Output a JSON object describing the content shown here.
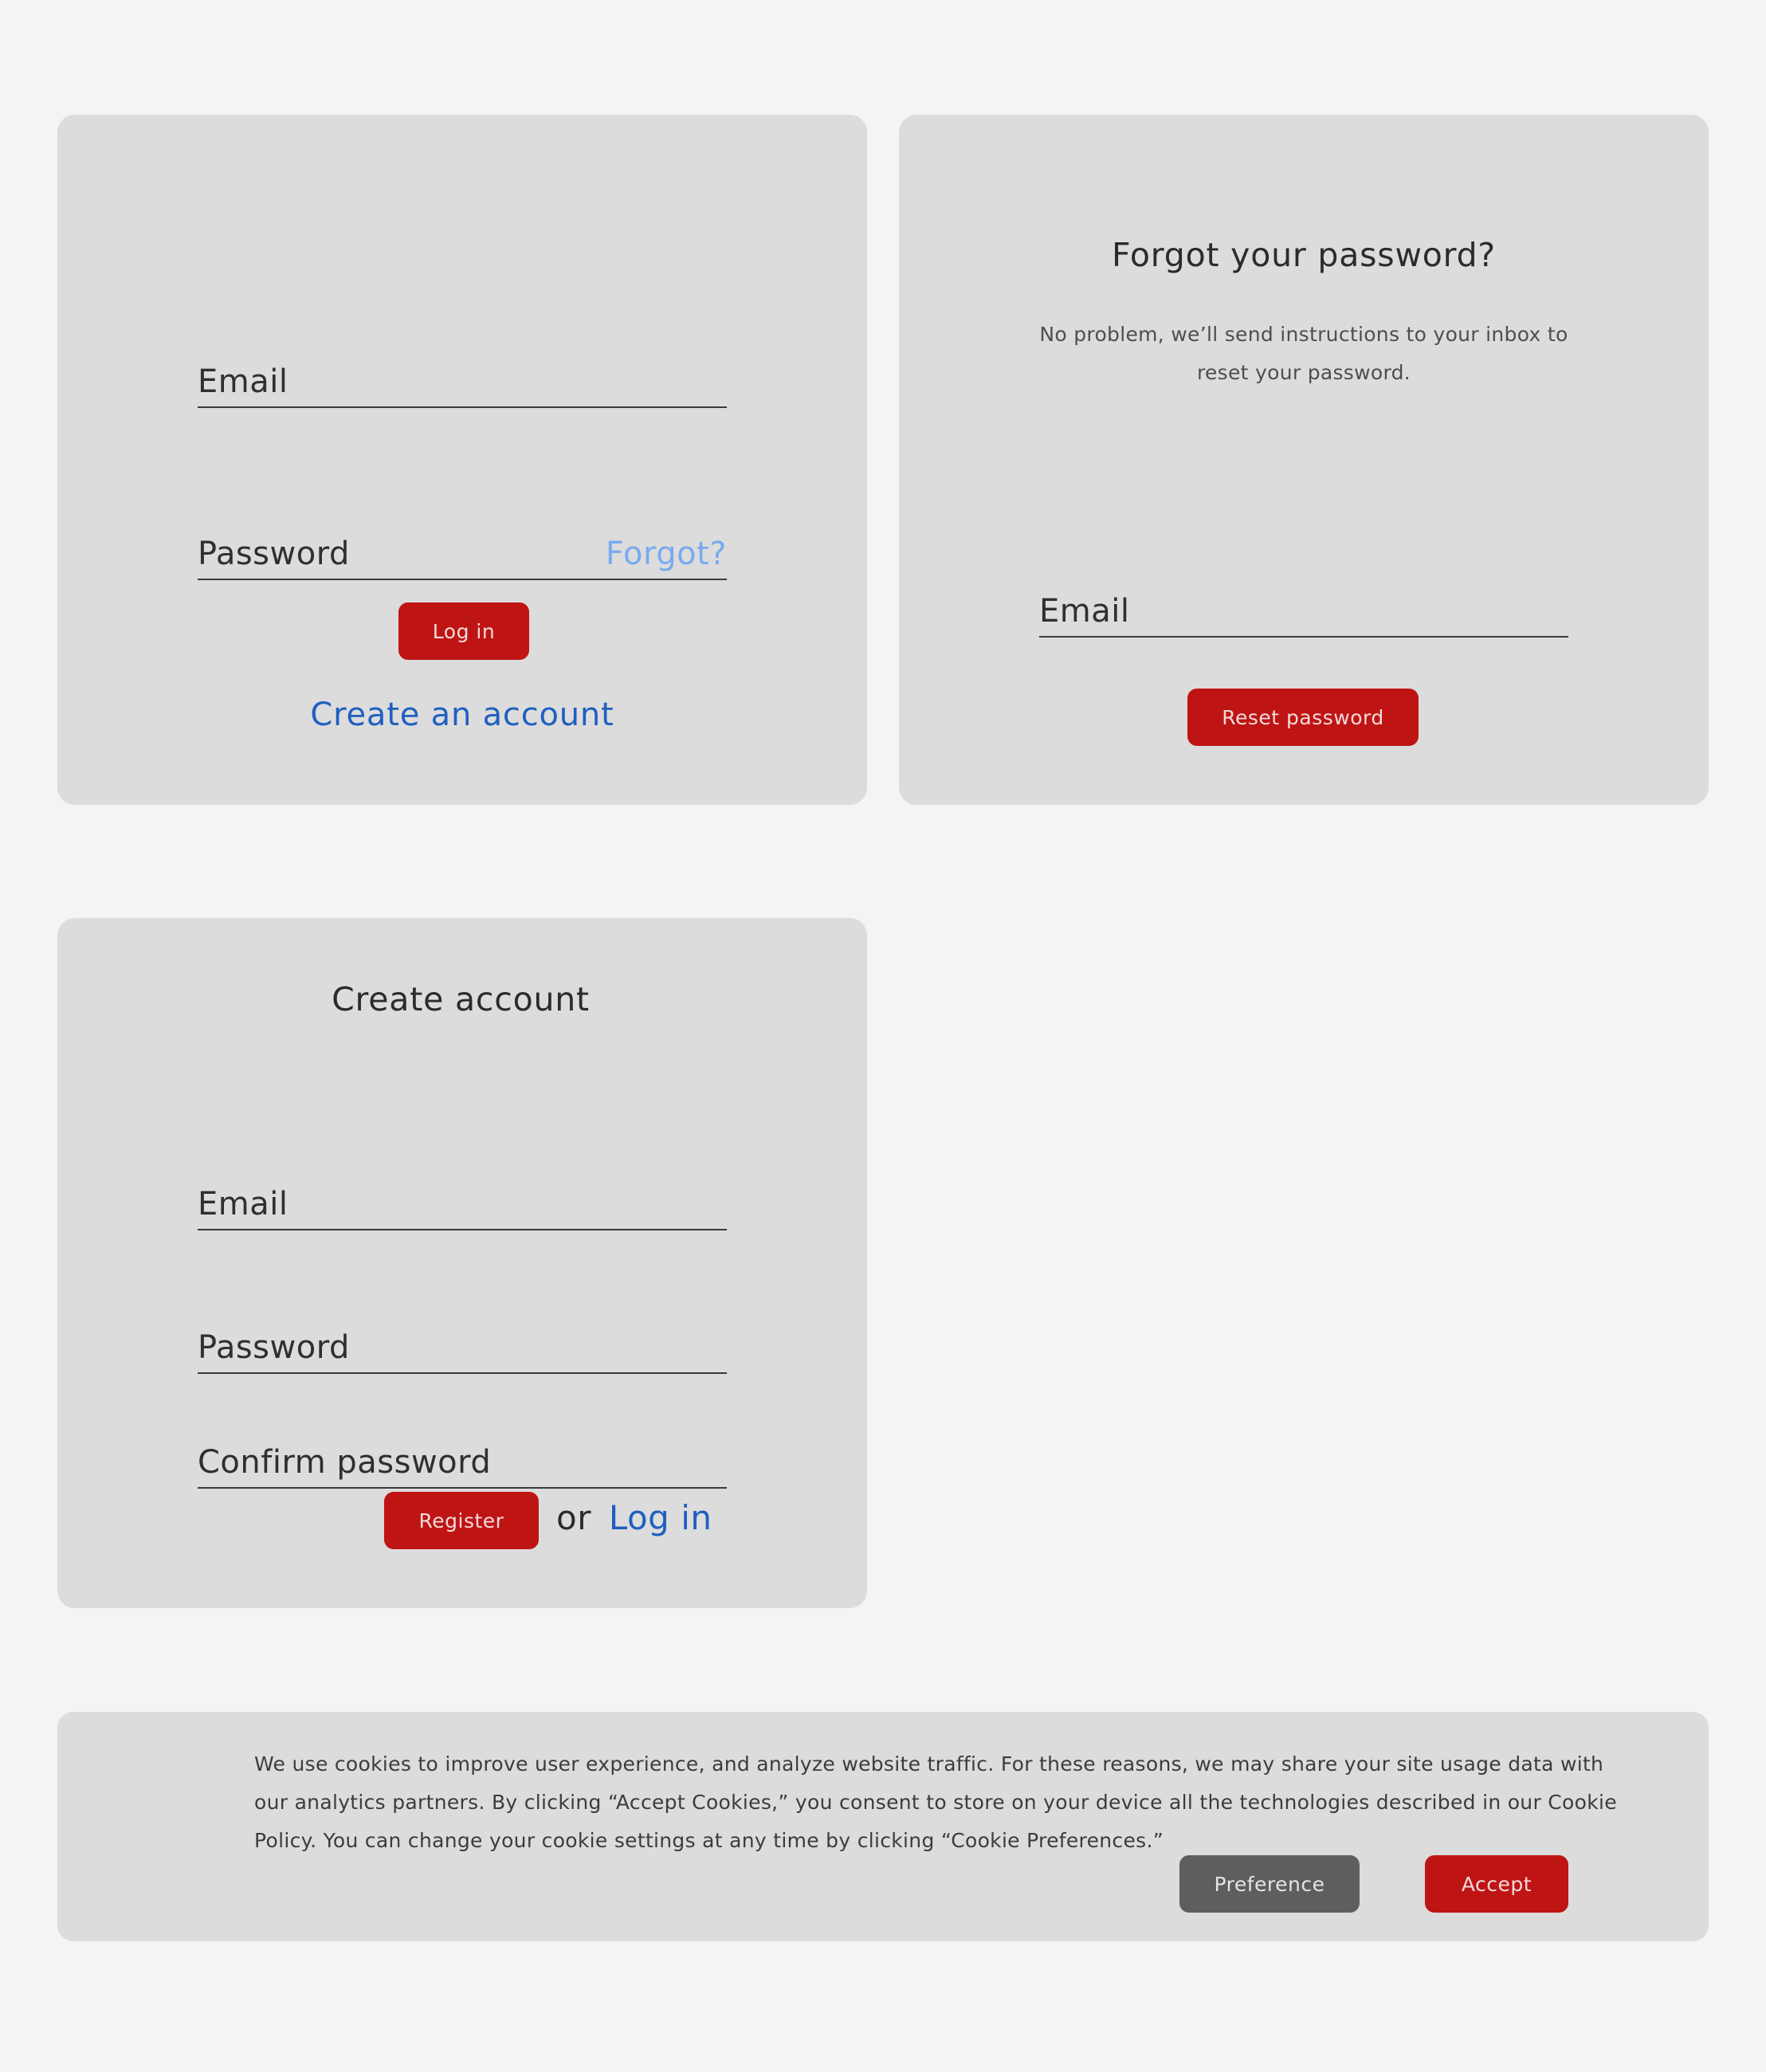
{
  "login": {
    "email_label": "Email",
    "password_label": "Password",
    "forgot_label": "Forgot?",
    "login_button": "Log in",
    "create_account_link": "Create an account"
  },
  "forgot": {
    "title": "Forgot your password?",
    "description": "No problem, we’ll send instructions to your inbox to reset your password.",
    "email_label": "Email",
    "reset_button": "Reset password"
  },
  "register": {
    "title": "Create account",
    "email_label": "Email",
    "password_label": "Password",
    "confirm_label": "Confirm password",
    "register_button": "Register",
    "or_text": "or",
    "login_link": "Log in"
  },
  "cookies": {
    "message": "We use cookies to improve user experience, and analyze website traffic. For these reasons, we may share your site usage data with our analytics partners. By clicking “Accept Cookies,” you consent to store on your device all the technologies described in our Cookie Policy. You can change your cookie settings at any time by clicking “Cookie Preferences.”",
    "preference_button": "Preference",
    "accept_button": "Accept"
  },
  "colors": {
    "page_bg": "#f4f4f4",
    "card_bg": "#dcdcdc",
    "primary_button": "#bf1414",
    "secondary_button": "#5e5e5e",
    "link": "#1f5fc0",
    "link_light": "#7aaaf0"
  }
}
